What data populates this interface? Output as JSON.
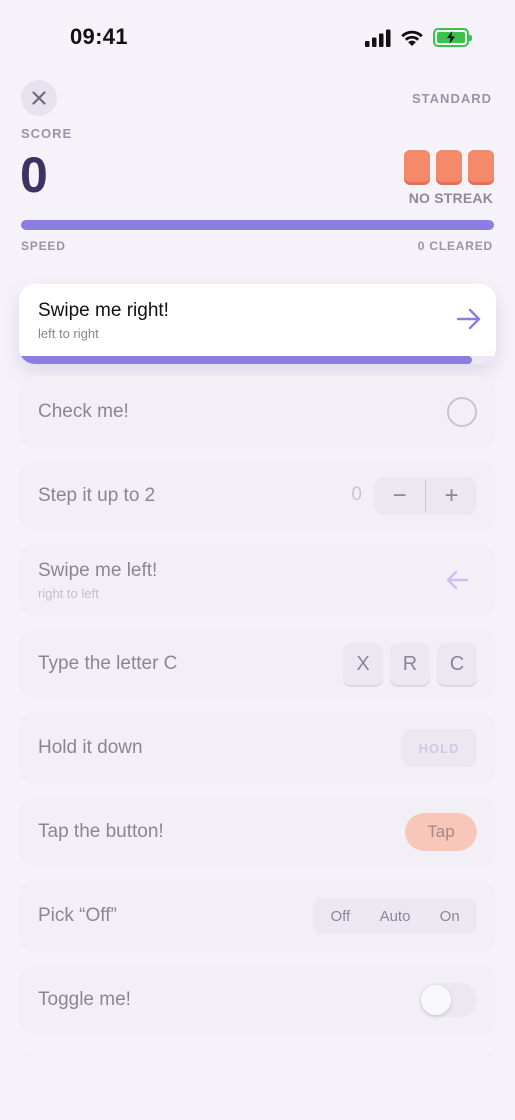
{
  "status_bar": {
    "time": "09:41"
  },
  "header": {
    "mode": "STANDARD",
    "score_label": "SCORE",
    "score": "0",
    "streak_label": "NO STREAK",
    "streak_blocks": 3,
    "speed_label": "SPEED",
    "cleared_label": "0 CLEARED",
    "speed_progress": 1.0
  },
  "colors": {
    "accent": "#8c7ee0",
    "streak": "#f48a6a",
    "score": "#3b3463",
    "tap": "#f9c7b9"
  },
  "tasks": {
    "swipe_right": {
      "title": "Swipe me right!",
      "subtitle": "left to right",
      "icon": "arrow-right-icon",
      "progress": 0.95
    },
    "check": {
      "title": "Check me!",
      "icon": "circle-check-icon"
    },
    "stepper": {
      "title": "Step it up to 2",
      "value": "0",
      "minus": "−",
      "plus": "+"
    },
    "swipe_left": {
      "title": "Swipe me left!",
      "subtitle": "right to left",
      "icon": "arrow-left-icon"
    },
    "type_letter": {
      "title": "Type the letter C",
      "keys": [
        "X",
        "R",
        "C"
      ]
    },
    "hold": {
      "title": "Hold it down",
      "button": "HOLD"
    },
    "tap": {
      "title": "Tap the button!",
      "button": "Tap"
    },
    "pick": {
      "title": "Pick “Off”",
      "options": [
        "Off",
        "Auto",
        "On"
      ]
    },
    "toggle": {
      "title": "Toggle me!",
      "state": "off"
    }
  }
}
